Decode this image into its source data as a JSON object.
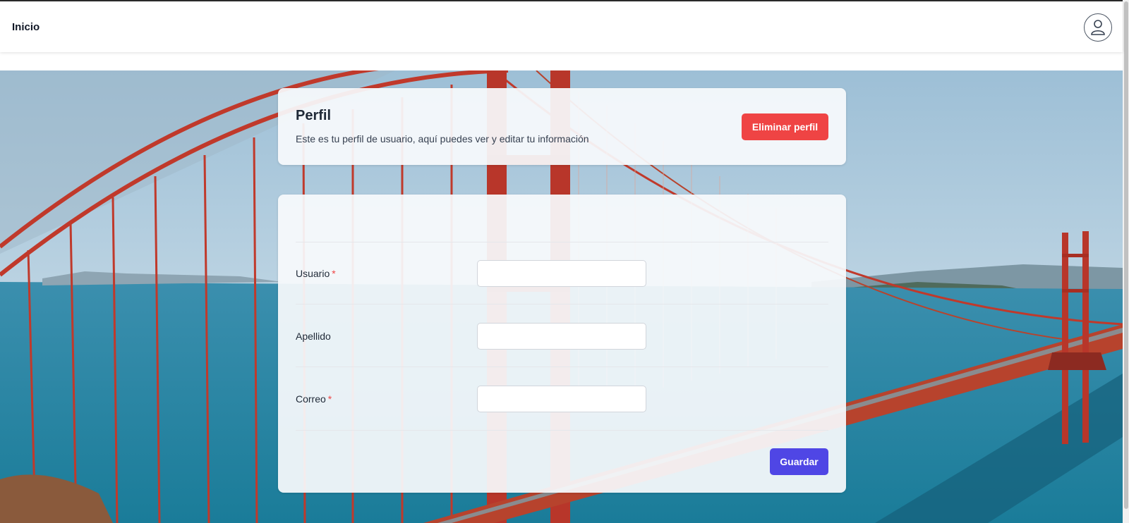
{
  "navbar": {
    "home_label": "Inicio",
    "avatar_icon": "user-circle-icon"
  },
  "background": {
    "image_kind": "photo-bridge-over-bay"
  },
  "profile_header": {
    "title": "Perfil",
    "subtitle": "Este es tu perfil de usuario, aquí puedes ver y editar tu información",
    "delete_button_label": "Eliminar perfil"
  },
  "form": {
    "fields": [
      {
        "label": "Usuario",
        "required": true,
        "value": "",
        "placeholder": ""
      },
      {
        "label": "Apellido",
        "required": false,
        "value": "",
        "placeholder": ""
      },
      {
        "label": "Correo",
        "required": true,
        "value": "",
        "placeholder": ""
      }
    ],
    "required_marker": "*",
    "save_button_label": "Guardar"
  },
  "colors": {
    "danger": "#ef4444",
    "primary": "#4f46e5",
    "bridge": "#c0392b",
    "water": "#1f8fb0",
    "sky": "#b9d3e3"
  }
}
